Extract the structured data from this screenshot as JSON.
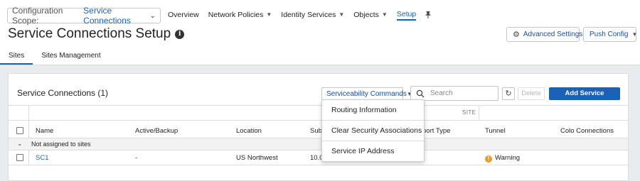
{
  "scope": {
    "label": "Configuration Scope:",
    "value": "Service Connections"
  },
  "nav": [
    {
      "label": "Overview",
      "dropdown": false,
      "active": false
    },
    {
      "label": "Network Policies",
      "dropdown": true,
      "active": false
    },
    {
      "label": "Identity Services",
      "dropdown": true,
      "active": false
    },
    {
      "label": "Objects",
      "dropdown": true,
      "active": false
    },
    {
      "label": "Setup",
      "dropdown": false,
      "active": true
    }
  ],
  "page": {
    "title": "Service Connections Setup",
    "info_glyph": "i"
  },
  "header_buttons": {
    "advanced_settings": "Advanced Settings",
    "push_config": "Push Config"
  },
  "tabs": [
    {
      "label": "Sites",
      "active": true
    },
    {
      "label": "Sites Management",
      "active": false
    }
  ],
  "card": {
    "title": "Service Connections (1)",
    "serviceability_label": "Serviceability Commands",
    "search_placeholder": "Search",
    "delete_label": "Delete",
    "add_label": "Add Service Connection",
    "site_group_label": "SITE"
  },
  "columns": [
    "Name",
    "Active/Backup",
    "Location",
    "Subn",
    "port Type",
    "Tunnel",
    "Colo Connections"
  ],
  "group_label": "Not assigned to sites",
  "rows": [
    {
      "name": "SC1",
      "active_backup": "-",
      "location": "US Northwest",
      "subnet": "10.0",
      "tunnel": "Warning"
    }
  ],
  "dropdown_items": [
    "Routing Information",
    "Clear Security Associations",
    "Service IP Address"
  ],
  "colors": {
    "accent": "#1a62b7",
    "warning": "#e79b2d"
  }
}
